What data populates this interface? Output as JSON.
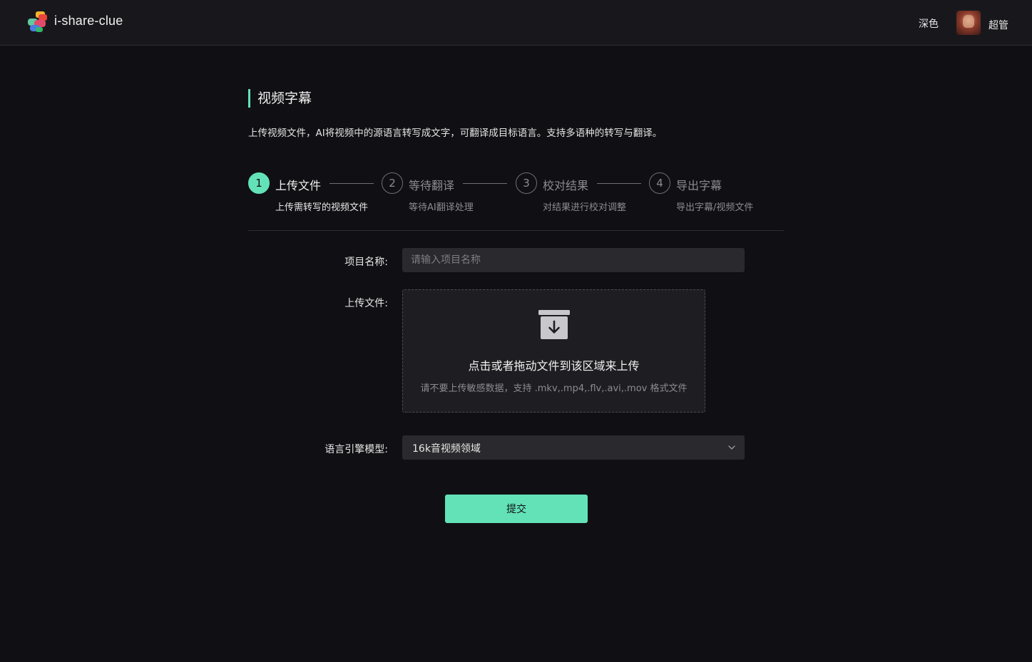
{
  "header": {
    "app_title": "i-share-clue",
    "theme_label": "深色",
    "username": "超管"
  },
  "page": {
    "title": "视频字幕",
    "description": "上传视频文件，AI将视频中的源语言转写成文字，可翻译成目标语言。支持多语种的转写与翻译。"
  },
  "steps": [
    {
      "number": "1",
      "title": "上传文件",
      "subtitle": "上传需转写的视频文件",
      "active": true
    },
    {
      "number": "2",
      "title": "等待翻译",
      "subtitle": "等待AI翻译处理",
      "active": false
    },
    {
      "number": "3",
      "title": "校对结果",
      "subtitle": "对结果进行校对调整",
      "active": false
    },
    {
      "number": "4",
      "title": "导出字幕",
      "subtitle": "导出字幕/视频文件",
      "active": false
    }
  ],
  "form": {
    "project_name_label": "项目名称:",
    "project_name_placeholder": "请输入项目名称",
    "project_name_value": "",
    "upload_label": "上传文件:",
    "upload_main_text": "点击或者拖动文件到该区域来上传",
    "upload_hint_text": "请不要上传敏感数据，支持 .mkv,.mp4,.flv,.avi,.mov 格式文件",
    "engine_label": "语言引擎模型:",
    "engine_value": "16k音视频领域",
    "submit_label": "提交"
  },
  "colors": {
    "accent": "#63e2b7",
    "background": "#101014",
    "header": "#18181c",
    "input": "#2a2a2e"
  },
  "icons": {
    "logo": "app-logo-icon",
    "upload": "archive-download-icon",
    "select": "chevron-down-icon"
  }
}
